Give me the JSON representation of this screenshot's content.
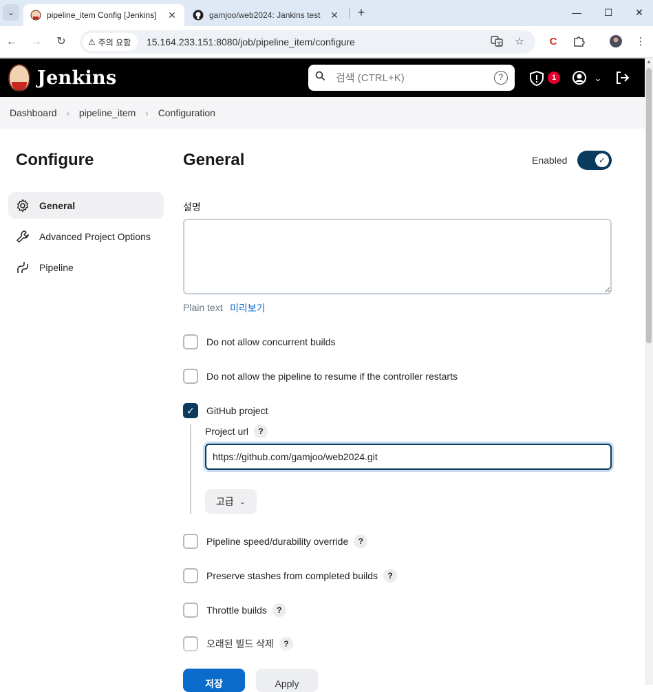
{
  "browser": {
    "tabs": [
      {
        "title": "pipeline_item Config [Jenkins]",
        "active": true
      },
      {
        "title": "gamjoo/web2024: Jankins test",
        "active": false
      }
    ],
    "security_label": "주의 요함",
    "url": "15.164.233.151:8080/job/pipeline_item/configure"
  },
  "jenkins": {
    "brand": "Jenkins",
    "search_placeholder": "검색 (CTRL+K)",
    "alert_count": "1"
  },
  "breadcrumb": [
    "Dashboard",
    "pipeline_item",
    "Configuration"
  ],
  "sidebar": {
    "title": "Configure",
    "items": [
      {
        "label": "General",
        "icon": "gear-icon",
        "active": true
      },
      {
        "label": "Advanced Project Options",
        "icon": "wrench-icon",
        "active": false
      },
      {
        "label": "Pipeline",
        "icon": "pipeline-icon",
        "active": false
      }
    ]
  },
  "main": {
    "title": "General",
    "enabled_label": "Enabled",
    "enabled": true,
    "description_label": "설명",
    "description_value": "",
    "plain_text_label": "Plain text",
    "preview_link": "미리보기",
    "options": {
      "concurrent": {
        "label": "Do not allow concurrent builds",
        "checked": false
      },
      "resume": {
        "label": "Do not allow the pipeline to resume if the controller restarts",
        "checked": false
      },
      "github": {
        "label": "GitHub project",
        "checked": true
      },
      "speed": {
        "label": "Pipeline speed/durability override",
        "checked": false
      },
      "stashes": {
        "label": "Preserve stashes from completed builds",
        "checked": false
      },
      "throttle": {
        "label": "Throttle builds",
        "checked": false
      },
      "discard": {
        "label": "오래된 빌드 삭제",
        "checked": false
      }
    },
    "project_url_label": "Project url",
    "project_url_value": "https://github.com/gamjoo/web2024.git",
    "advanced_button": "고급"
  },
  "actions": {
    "save": "저장",
    "apply": "Apply"
  },
  "colors": {
    "accent": "#0a3a5e",
    "link": "#0b6bcb",
    "header": "#000000"
  }
}
